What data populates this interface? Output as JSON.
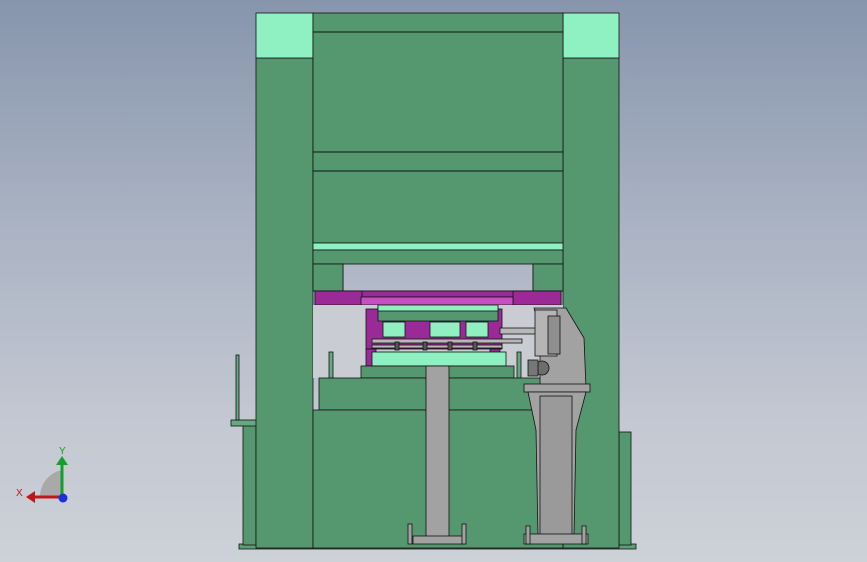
{
  "viewport": {
    "background_top": "#8795ad",
    "background_bottom": "#cdd1d8"
  },
  "model": {
    "frame_color": "#55986f",
    "frame_light_color": "#8eeec0",
    "mint_strip_color": "#8ff0c2",
    "die_color": "#9b2a98",
    "die_light_color": "#c74fc4",
    "feeder_color": "#a2a2a2",
    "edge_color": "#111111"
  },
  "triad": {
    "x_label": "X",
    "y_label": "Y",
    "x_color": "#c0161a",
    "y_color": "#12a02a",
    "z_color": "#1c2fd8"
  }
}
